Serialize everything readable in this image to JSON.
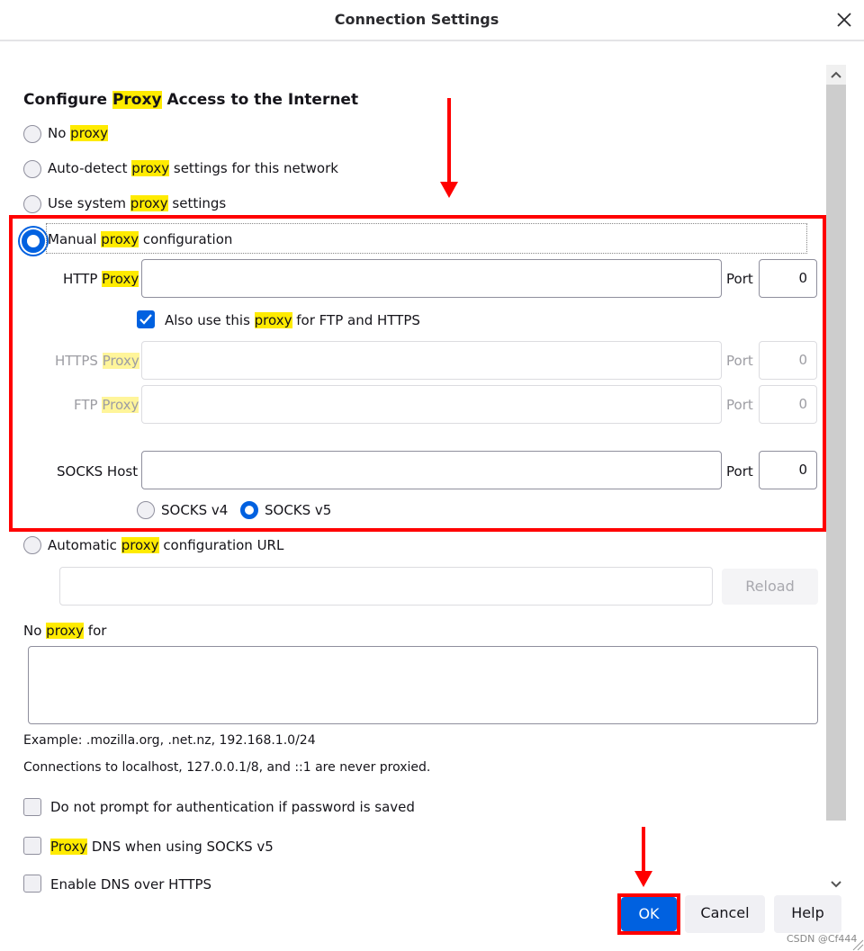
{
  "dialog": {
    "title": "Connection Settings",
    "close_icon": "close-icon"
  },
  "section": {
    "heading_pre": "Configure ",
    "heading_hl": "Proxy",
    "heading_post": " Access to the Internet"
  },
  "proxy_options": [
    {
      "pre": "No ",
      "hl": "proxy",
      "post": "",
      "checked": false
    },
    {
      "pre": "Auto-detect ",
      "hl": "proxy",
      "post": " settings for this network",
      "checked": false
    },
    {
      "pre": "Use system ",
      "hl": "proxy",
      "post": " settings",
      "checked": false
    },
    {
      "pre": "Manual ",
      "hl": "proxy",
      "post": " configuration",
      "checked": true
    },
    {
      "pre": "Automatic ",
      "hl": "proxy",
      "post": " configuration URL",
      "checked": false
    }
  ],
  "manual": {
    "http_label_pre": "HTTP ",
    "http_label_hl": "Proxy",
    "http_value": "",
    "http_port_label": "Port",
    "http_port": "0",
    "also_use_pre": "Also use this ",
    "also_use_hl": "proxy",
    "also_use_post": " for FTP and HTTPS",
    "also_use_checked": true,
    "https_label_pre": "HTTPS ",
    "https_label_hl": "Proxy",
    "https_value": "",
    "https_port_label": "Port",
    "https_port": "0",
    "ftp_label_pre": "FTP ",
    "ftp_label_hl": "Proxy",
    "ftp_value": "",
    "ftp_port_label": "Port",
    "ftp_port": "0",
    "socks_label": "SOCKS Host",
    "socks_value": "",
    "socks_port_label": "Port",
    "socks_port": "0",
    "socks_v4_label": "SOCKS v4",
    "socks_v5_label": "SOCKS v5",
    "socks_version_selected": "v5"
  },
  "auto_url": {
    "value": "",
    "reload_label": "Reload"
  },
  "no_proxy": {
    "label_pre": "No ",
    "label_hl": "proxy",
    "label_post": " for",
    "value": "",
    "example": "Example: .mozilla.org, .net.nz, 192.168.1.0/24",
    "note": "Connections to localhost, 127.0.0.1/8, and ::1 are never proxied."
  },
  "checkboxes": [
    {
      "pre": "",
      "hl": "",
      "post": "Do not prompt for authentication if password is saved",
      "checked": false
    },
    {
      "pre": "",
      "hl": "Proxy",
      "post": " DNS when using SOCKS v5",
      "checked": false
    },
    {
      "pre": "",
      "hl": "",
      "post": "Enable DNS over HTTPS",
      "checked": false
    }
  ],
  "buttons": {
    "ok": "OK",
    "cancel": "Cancel",
    "help": "Help"
  },
  "colors": {
    "accent": "#0061e0",
    "highlight": "#ffeb00",
    "annotation": "#ff0000"
  },
  "watermark": "CSDN @Cf444"
}
